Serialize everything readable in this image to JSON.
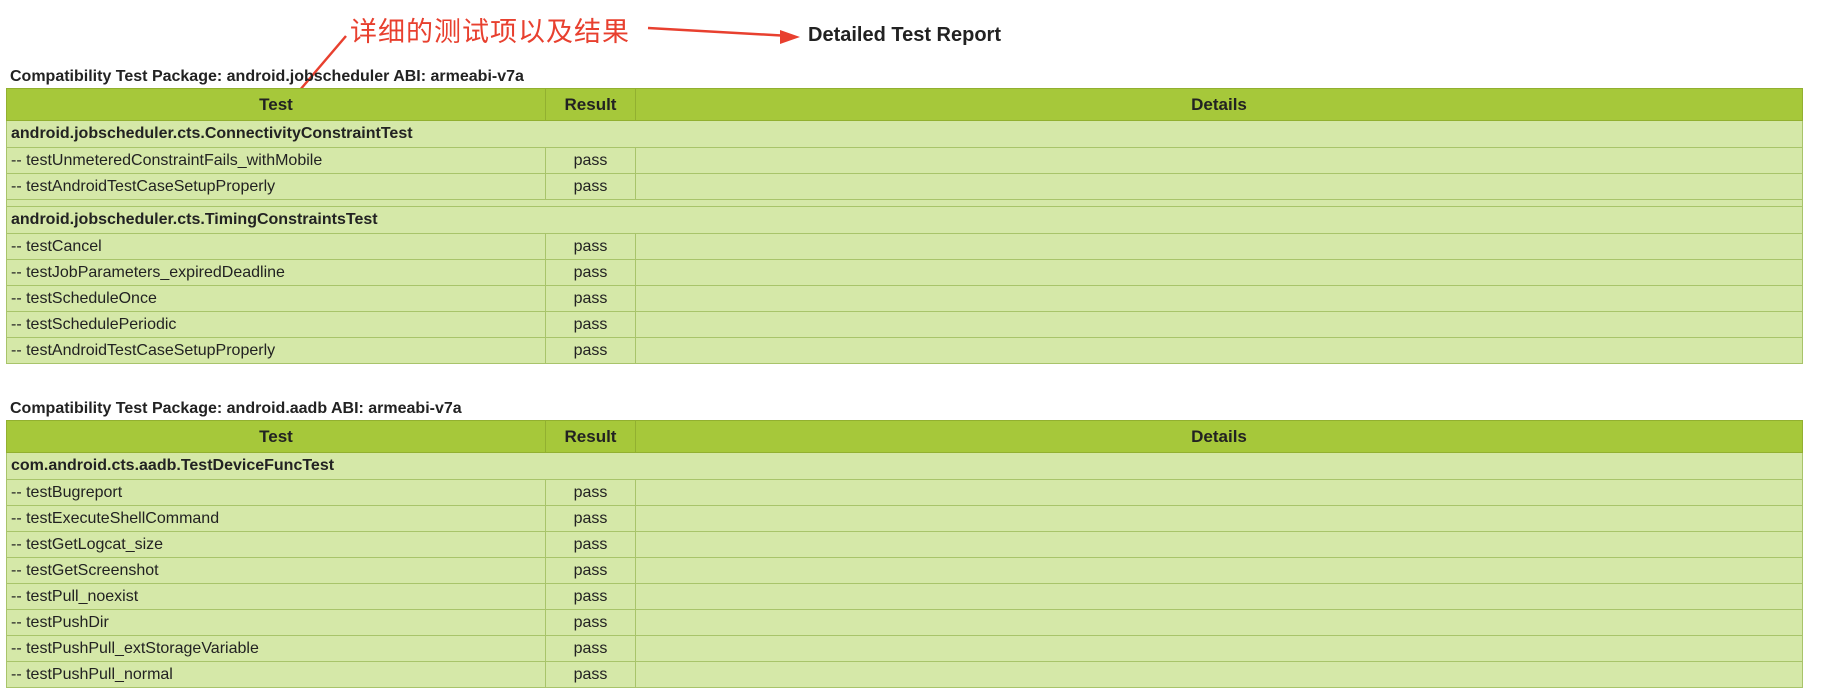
{
  "report_title": "Detailed Test Report",
  "annotation": {
    "text": "详细的测试项以及结果",
    "color": "#e8402f"
  },
  "colors": {
    "header_bg": "#a6c83a",
    "row_bg": "#d5e8a8"
  },
  "columns": {
    "test": "Test",
    "result": "Result",
    "details": "Details"
  },
  "packages": [
    {
      "title": "Compatibility Test Package: android.jobscheduler ABI: armeabi-v7a",
      "classes": [
        {
          "name": "android.jobscheduler.cts.ConnectivityConstraintTest",
          "tests": [
            {
              "name": "-- testUnmeteredConstraintFails_withMobile",
              "result": "pass",
              "details": ""
            },
            {
              "name": "-- testAndroidTestCaseSetupProperly",
              "result": "pass",
              "details": ""
            }
          ]
        },
        {
          "name": "android.jobscheduler.cts.TimingConstraintsTest",
          "tests": [
            {
              "name": "-- testCancel",
              "result": "pass",
              "details": ""
            },
            {
              "name": "-- testJobParameters_expiredDeadline",
              "result": "pass",
              "details": ""
            },
            {
              "name": "-- testScheduleOnce",
              "result": "pass",
              "details": ""
            },
            {
              "name": "-- testSchedulePeriodic",
              "result": "pass",
              "details": ""
            },
            {
              "name": "-- testAndroidTestCaseSetupProperly",
              "result": "pass",
              "details": ""
            }
          ]
        }
      ]
    },
    {
      "title": "Compatibility Test Package: android.aadb ABI: armeabi-v7a",
      "classes": [
        {
          "name": "com.android.cts.aadb.TestDeviceFuncTest",
          "tests": [
            {
              "name": "-- testBugreport",
              "result": "pass",
              "details": ""
            },
            {
              "name": "-- testExecuteShellCommand",
              "result": "pass",
              "details": ""
            },
            {
              "name": "-- testGetLogcat_size",
              "result": "pass",
              "details": ""
            },
            {
              "name": "-- testGetScreenshot",
              "result": "pass",
              "details": ""
            },
            {
              "name": "-- testPull_noexist",
              "result": "pass",
              "details": ""
            },
            {
              "name": "-- testPushDir",
              "result": "pass",
              "details": ""
            },
            {
              "name": "-- testPushPull_extStorageVariable",
              "result": "pass",
              "details": ""
            },
            {
              "name": "-- testPushPull_normal",
              "result": "pass",
              "details": ""
            }
          ]
        }
      ]
    }
  ]
}
